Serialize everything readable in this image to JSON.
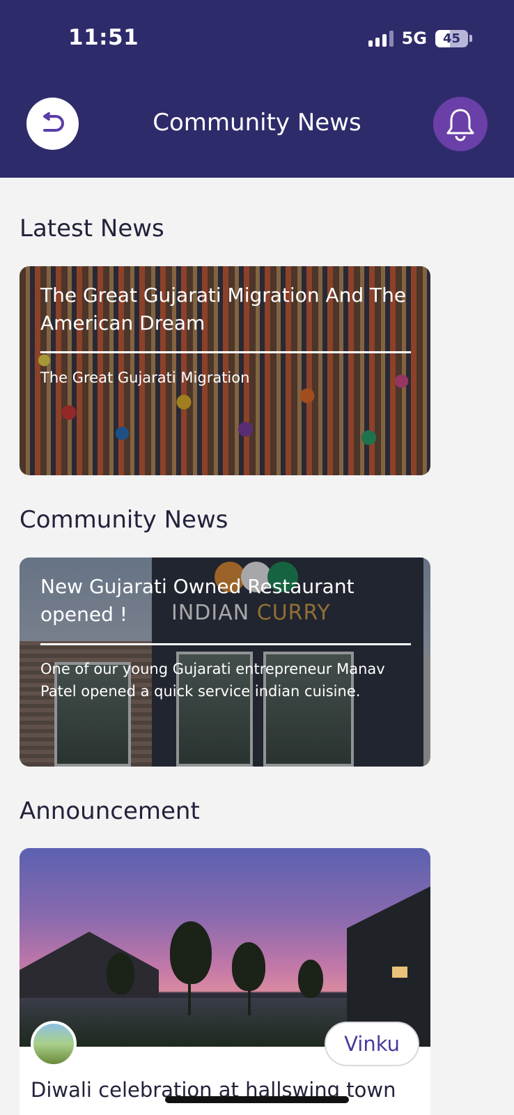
{
  "status_bar": {
    "time": "11:51",
    "network": "5G",
    "battery": "45",
    "battery_level": 0.45
  },
  "header": {
    "title": "Community News",
    "back_icon": "back-arrow-icon",
    "bell_icon": "bell-icon",
    "colors": {
      "header_bg": "#2e2b6b",
      "bell_bg": "#6b3fa8"
    }
  },
  "sections": {
    "latest": {
      "heading": "Latest News",
      "card": {
        "title": "The Great Gujarati Migration And The American Dream",
        "subtitle": "The Great Gujarati Migration"
      }
    },
    "community": {
      "heading": "Community News",
      "card": {
        "title": "New Gujarati Owned Restaurant opened !",
        "subtitle": "One of our young Gujarati entrepreneur Manav Patel opened a quick service indian cuisine.",
        "sign_word1": "INDIAN",
        "sign_word2": "CURRY"
      }
    },
    "announcement": {
      "heading": "Announcement",
      "card": {
        "author": "Vinku",
        "title": "Diwali celebration at hallswing town"
      }
    }
  }
}
